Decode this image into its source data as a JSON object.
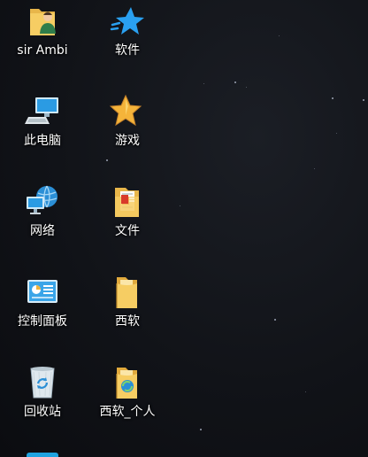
{
  "desktop": {
    "icons": [
      {
        "label": "sir Ambi",
        "icon": "user-folder-icon"
      },
      {
        "label": "软件",
        "icon": "blue-star-icon"
      },
      {
        "label": "此电脑",
        "icon": "computer-icon"
      },
      {
        "label": "游戏",
        "icon": "gold-star-icon"
      },
      {
        "label": "网络",
        "icon": "network-icon"
      },
      {
        "label": "文件",
        "icon": "document-folder-icon"
      },
      {
        "label": "控制面板",
        "icon": "control-panel-icon"
      },
      {
        "label": "西软",
        "icon": "folder-icon"
      },
      {
        "label": "回收站",
        "icon": "recycle-bin-icon"
      },
      {
        "label": "西软_个人",
        "icon": "shared-folder-icon"
      }
    ]
  }
}
